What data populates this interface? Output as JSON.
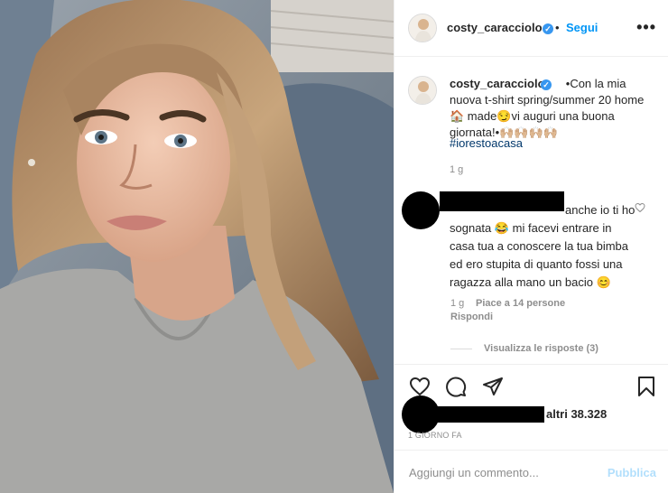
{
  "post": {
    "author": "costy_caracciolo",
    "follow_label": "Segui",
    "separator": "•",
    "more_label": "•••",
    "caption": "•Con la mia nuova t-shirt spring/summer 20 home🏠 made😏vi auguri una buona giornata!•🙌🏼🙌🏼🙌🏼🙌🏼",
    "hashtag": "#iorestoacasa",
    "caption_age": "1 g"
  },
  "comment": {
    "text": "anche io ti ho sognata 😂 mi facevi entrare in casa tua a conoscere la tua bimba ed ero stupita di quanto fossi una ragazza alla mano un bacio 😊",
    "age": "1 g",
    "likes": "Piace a 14 persone",
    "reply_label": "Rispondi",
    "view_replies": "Visualizza le risposte (3)"
  },
  "likes_summary": "altri 38.328",
  "date": "1 GIORNO FA",
  "add_comment": {
    "placeholder": "Aggiungi un commento...",
    "publish_label": "Pubblica"
  },
  "colors": {
    "accent": "#0095f6",
    "verified": "#3897f0",
    "muted": "#8e8e8e",
    "hashtag": "#00376b"
  }
}
